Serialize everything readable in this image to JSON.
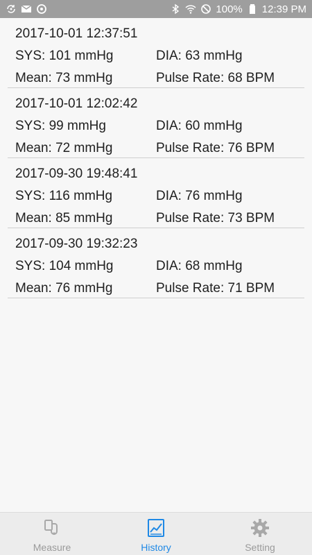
{
  "status_bar": {
    "battery_text": "100%",
    "time": "12:39 PM",
    "left_icons": [
      "sync-icon",
      "mail-icon",
      "data-saver-icon"
    ],
    "right_icons": [
      "bluetooth-icon",
      "wifi-icon",
      "do-not-disturb-icon",
      "battery-icon"
    ],
    "background": "#9e9e9e"
  },
  "records": [
    {
      "timestamp": "2017-10-01 12:37:51",
      "sys": "SYS: 101 mmHg",
      "dia": "DIA: 63 mmHg",
      "mean": "Mean: 73 mmHg",
      "pulse": "Pulse Rate: 68 BPM"
    },
    {
      "timestamp": "2017-10-01 12:02:42",
      "sys": "SYS: 99 mmHg",
      "dia": "DIA: 60 mmHg",
      "mean": "Mean: 72 mmHg",
      "pulse": "Pulse Rate: 76 BPM"
    },
    {
      "timestamp": "2017-09-30 19:48:41",
      "sys": "SYS: 116 mmHg",
      "dia": "DIA: 76 mmHg",
      "mean": "Mean: 85 mmHg",
      "pulse": "Pulse Rate: 73 BPM"
    },
    {
      "timestamp": "2017-09-30 19:32:23",
      "sys": "SYS: 104 mmHg",
      "dia": "DIA: 68 mmHg",
      "mean": "Mean: 76 mmHg",
      "pulse": "Pulse Rate: 71 BPM"
    }
  ],
  "bottom_nav": {
    "items": [
      {
        "label": "Measure",
        "icon": "measure-icon",
        "active": false
      },
      {
        "label": "History",
        "icon": "history-chart-icon",
        "active": true
      },
      {
        "label": "Setting",
        "icon": "gear-icon",
        "active": false
      }
    ],
    "active_color": "#1e88e5",
    "inactive_color": "#9a9a9a"
  }
}
